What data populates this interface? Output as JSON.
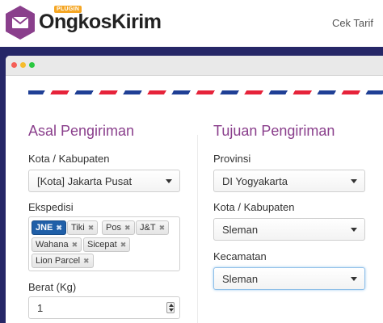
{
  "header": {
    "brand": "OngkosKirim",
    "badge": "PLUGIN",
    "nav_link": "Cek Tarif"
  },
  "colors": {
    "accent": "#8a3f8c",
    "stage_bg": "#262767",
    "selected_tag": "#1f5fa8"
  },
  "origin": {
    "title": "Asal Pengiriman",
    "city_label": "Kota / Kabupaten",
    "city_value": "[Kota] Jakarta Pusat",
    "couriers_label": "Ekspedisi",
    "couriers": [
      {
        "label": "JNE",
        "selected": true
      },
      {
        "label": "Tiki",
        "selected": false
      },
      {
        "label": "Pos",
        "selected": false
      },
      {
        "label": "J&T",
        "selected": false
      },
      {
        "label": "Wahana",
        "selected": false
      },
      {
        "label": "Sicepat",
        "selected": false
      },
      {
        "label": "Lion Parcel",
        "selected": false
      }
    ],
    "weight_label": "Berat (Kg)",
    "weight_value": "1"
  },
  "destination": {
    "title": "Tujuan Pengiriman",
    "province_label": "Provinsi",
    "province_value": "DI Yogyakarta",
    "city_label": "Kota / Kabupaten",
    "city_value": "Sleman",
    "district_label": "Kecamatan",
    "district_value": "Sleman"
  },
  "tag_remove_glyph": "✖"
}
